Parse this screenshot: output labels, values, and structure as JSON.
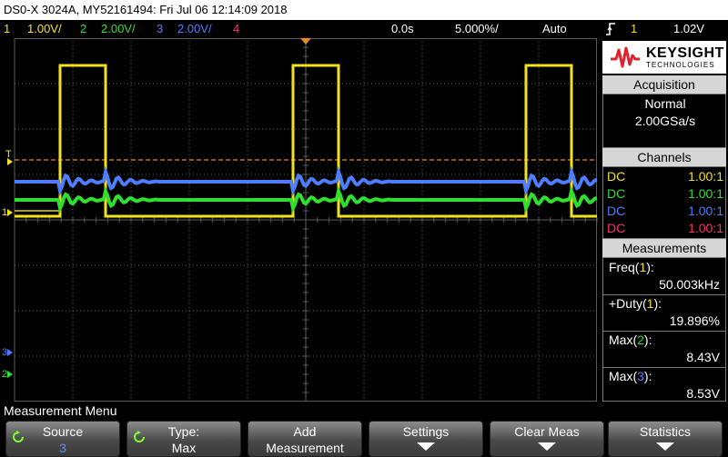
{
  "title_bar": {
    "text": "DS0-X 3024A, MY52161494: Fri Jul 06 12:14:09 2018"
  },
  "status_bar": {
    "ch1": {
      "num": "1",
      "scale": "1.00V/",
      "color": "#f2e21b"
    },
    "ch2": {
      "num": "2",
      "scale": "2.00V/",
      "color": "#2fe02f"
    },
    "ch3": {
      "num": "3",
      "scale": "2.00V/",
      "color": "#4f7dff"
    },
    "ch4": {
      "num": "4",
      "color": "#ff2f6d"
    },
    "delay": "0.0s",
    "timebase": "5.000%/",
    "mode": "Auto",
    "trigger_icon": "rising-edge-icon",
    "trigger_source": "1",
    "trigger_level": "1.02V"
  },
  "brand": {
    "wordmark": "KEYSIGHT",
    "sub": "TECHNOLOGIES"
  },
  "acquisition": {
    "heading": "Acquisition",
    "mode": "Normal",
    "rate": "2.00GSa/s"
  },
  "channels": {
    "heading": "Channels",
    "rows": [
      {
        "coupling": "DC",
        "ratio": "1.00:1",
        "color": "#f2e21b"
      },
      {
        "coupling": "DC",
        "ratio": "1.00:1",
        "color": "#2fe02f"
      },
      {
        "coupling": "DC",
        "ratio": "1.00:1",
        "color": "#4f7dff"
      },
      {
        "coupling": "DC",
        "ratio": "1.00:1",
        "color": "#ff2f6d"
      }
    ]
  },
  "measurements": {
    "heading": "Measurements",
    "items": [
      {
        "name": "Freq",
        "ch": "1",
        "value": "50.003kHz"
      },
      {
        "name": "+Duty",
        "ch": "1",
        "value": "19.896%"
      },
      {
        "name": "Max",
        "ch": "2",
        "value": "8.43V"
      },
      {
        "name": "Max",
        "ch": "3",
        "value": "8.53V"
      }
    ]
  },
  "graticule": {
    "trigger_marker": "T",
    "ch1_marker": "1",
    "ch2_marker": "2",
    "ch3_marker": "3"
  },
  "menu_title": "Measurement Menu",
  "softkeys": [
    {
      "line1": "Source",
      "line2": "3"
    },
    {
      "line1": "Type:",
      "line2": "Max"
    },
    {
      "line1": "Add",
      "line2": "Measurement"
    },
    {
      "line1": "Settings",
      "line2": ""
    },
    {
      "line1": "Clear Meas",
      "line2": ""
    },
    {
      "line1": "Statistics",
      "line2": ""
    }
  ],
  "colors": {
    "ch1": "#f2e21b",
    "ch2": "#2fe02f",
    "ch3": "#4f7dff",
    "ch4": "#ff2f6d",
    "trigger_level_line": "#e08a2a",
    "grid": "#5a5a5a",
    "panel_header": "#d6d6d6"
  }
}
